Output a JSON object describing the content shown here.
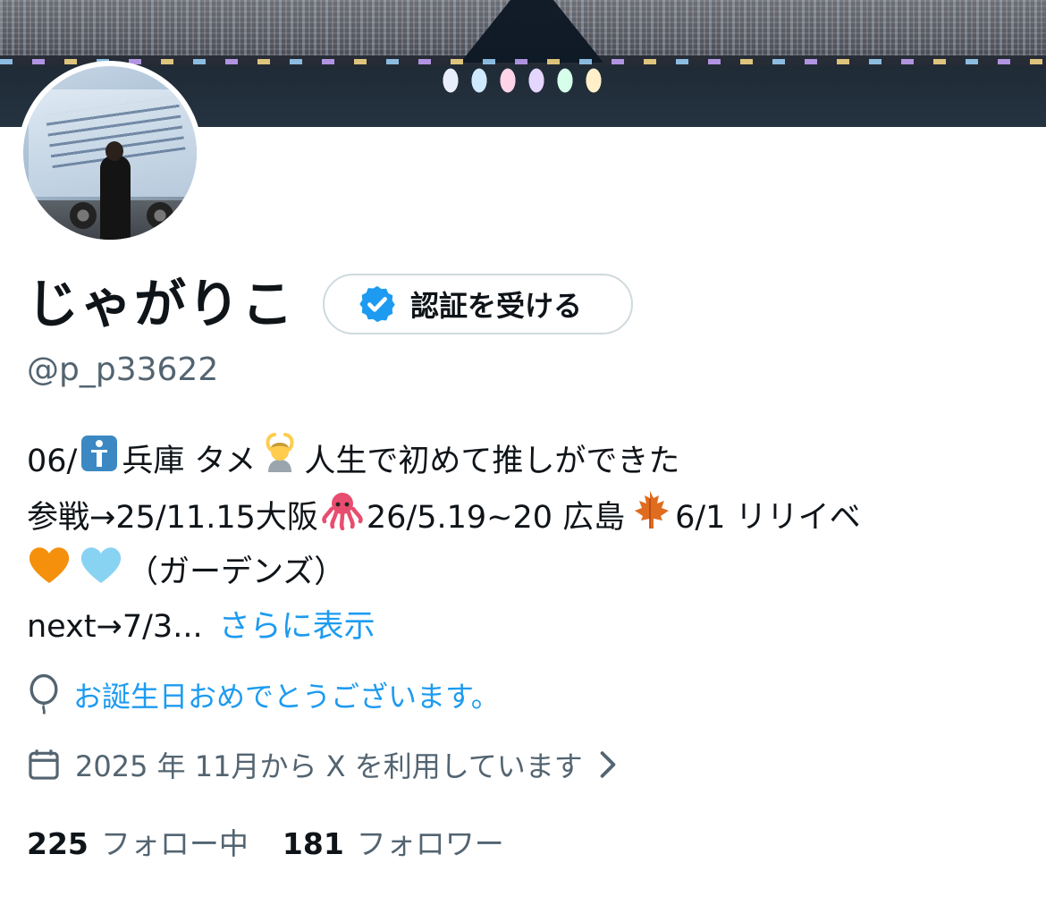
{
  "profile": {
    "display_name": "じゃがりこ",
    "handle": "@p_p33622",
    "verify_button_label": "認証を受ける"
  },
  "bio": {
    "line1": {
      "part1": "06/",
      "emoji1": "person-standing-blue-square-emoji",
      "part2": "兵庫 タメ",
      "emoji2": "person-gesturing-ok-emoji",
      "part3": "人生で初めて推しができた"
    },
    "line2": {
      "part1": "参戦→25/11.15大阪",
      "emoji1": "octopus-emoji",
      "part2": "26/5.19~20 広島",
      "emoji2": "maple-leaf-emoji",
      "part3": "6/1 リリイベ"
    },
    "line3": {
      "emoji1": "orange-heart-emoji",
      "emoji2": "light-blue-heart-emoji",
      "part1": "（ガーデンズ）"
    },
    "line4": {
      "part1": "next→7/3...",
      "more_link": "さらに表示"
    }
  },
  "birthday": {
    "icon": "balloon-icon",
    "text": "お誕生日おめでとうございます。"
  },
  "joined": {
    "icon": "calendar-icon",
    "text": "2025 年 11月から X を利用しています",
    "chevron": "chevron-right-icon"
  },
  "stats": {
    "following_count": "225",
    "following_label": "フォロー中",
    "followers_count": "181",
    "followers_label": "フォロワー"
  },
  "colors": {
    "link_blue": "#1d9bf0",
    "secondary_text": "#536471",
    "primary_text": "#0f1419",
    "border": "#cfd9de"
  }
}
